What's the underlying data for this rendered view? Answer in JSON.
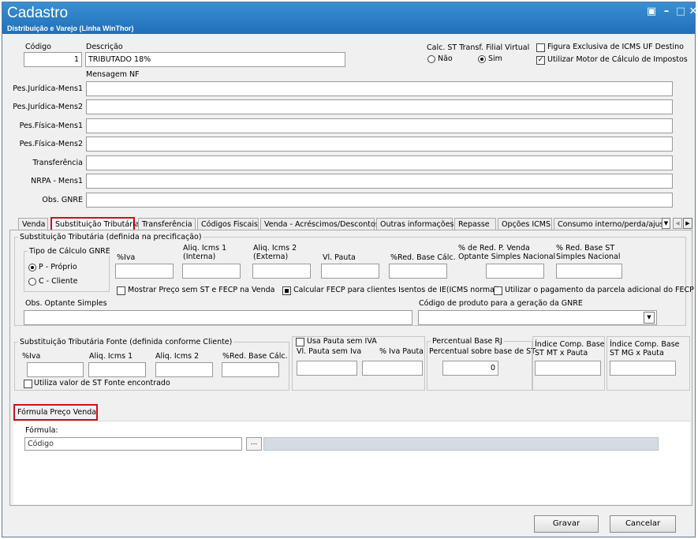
{
  "window": {
    "title": "Cadastro",
    "subtitle": "Distribuição e Varejo (Linha WinThor)"
  },
  "header": {
    "codigo_label": "Código",
    "codigo_value": "1",
    "descricao_label": "Descrição",
    "descricao_value": "TRIBUTADO 18%",
    "calc_st_label": "Calc. ST Transf. Filial Virtual",
    "radio_nao": "Não",
    "radio_sim": "Sim",
    "figura_label": "Figura Exclusiva de ICMS UF Destino",
    "motor_label": "Utilizar Motor de Cálculo de Impostos",
    "mensagem_nf_label": "Mensagem NF"
  },
  "messages": [
    {
      "label": "Pes.Jurídica-Mens1",
      "value": ""
    },
    {
      "label": "Pes.Jurídica-Mens2",
      "value": ""
    },
    {
      "label": "Pes.Física-Mens1",
      "value": ""
    },
    {
      "label": "Pes.Física-Mens2",
      "value": ""
    },
    {
      "label": "Transferência",
      "value": ""
    },
    {
      "label": "NRPA - Mens1",
      "value": ""
    },
    {
      "label": "Obs. GNRE",
      "value": ""
    }
  ],
  "tabs": [
    "Venda",
    "Substituição Tributária",
    "Transferência",
    "Códigos Fiscais",
    "Venda - Acréscimos/Descontos",
    "Outras informações",
    "Repasse",
    "Opções ICMS",
    "Consumo interno/perda/ajuste"
  ],
  "st": {
    "group_title": "Substituição Tributária (definida na precificação)",
    "tipo_calc_label": "Tipo de Cálculo GNRE",
    "tipo_p": "P - Próprio",
    "tipo_c": "C - Cliente",
    "iva_label": "%Iva",
    "aliq1_label": "Aliq. Icms 1 (Interna)",
    "aliq2_label": "Aliq. Icms 2 (Externa)",
    "vlpauta_label": "Vl. Pauta",
    "redbase_label": "%Red. Base Cálc.",
    "redpvenda_label": "% de Red. P. Venda Optante Simples Nacional",
    "redbasest_label": "% Red. Base ST Simples Nacional",
    "mostrar_preco_label": "Mostrar Preço sem ST e FECP na Venda",
    "calcular_fecp_label": "Calcular FECP para clientes Isentos de IE(ICMS normal)",
    "utilizar_pagamento_label": "Utilizar o pagamento da parcela adicional do FECP",
    "obs_optante_label": "Obs. Optante Simples",
    "codigo_gnre_label": "Código de produto para a geração da GNRE"
  },
  "st_fonte": {
    "group_title": "Substituição Tributária Fonte (definida conforme Cliente)",
    "iva_label": "%Iva",
    "aliq1_label": "Aliq. Icms 1",
    "aliq2_label": "Aliq. Icms 2",
    "redbase_label": "%Red. Base Cálc.",
    "utiliza_valor_label": "Utiliza valor de ST Fonte encontrado",
    "usa_pauta_label": "Usa Pauta sem IVA",
    "vlpauta_sem_iva_label": "Vl. Pauta sem Iva",
    "iva_pauta_label": "% Iva Pauta",
    "percentual_rj_title": "Percentual Base RJ",
    "percentual_sobre_label": "Percentual sobre base de ST",
    "percentual_value": "0",
    "indice_mt_label": "Índice Comp. Base ST MT x Pauta",
    "indice_mg_label": "Índice Comp. Base ST MG x Pauta"
  },
  "formula": {
    "section_title": "Fórmula Preço Venda",
    "formula_label": "Fórmula:",
    "formula_value": "Código",
    "ellipsis": "..."
  },
  "footer": {
    "gravar": "Gravar",
    "cancelar": "Cancelar"
  },
  "colors": {
    "titlebar": "#1f6fb8",
    "highlight": "#d0101a"
  }
}
